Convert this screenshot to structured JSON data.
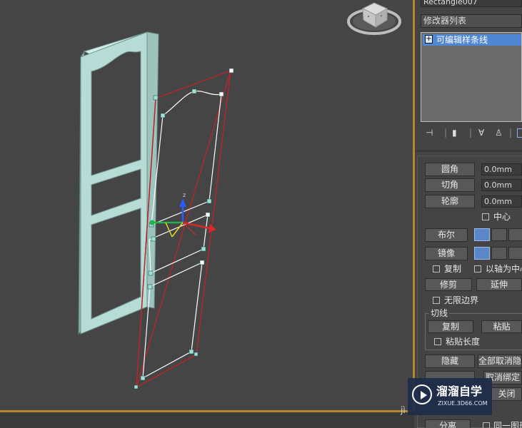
{
  "colors": {
    "viewport_bg": "#454545",
    "frame_fill": "#b7dcd6",
    "selection_red": "#b5262d",
    "spline_white": "#ffffff",
    "highlight_blue": "#4f87d2",
    "active_border": "#b8862f"
  },
  "viewport": {
    "object_name": "Rectangle007",
    "axis_label": "z"
  },
  "panel": {
    "modifier_list_label": "修改器列表",
    "modifier_stack": [
      {
        "label": "可编辑样条线",
        "expand_glyph": "+"
      }
    ],
    "toolbar_icons": [
      "pin-stack-icon",
      "show-end-result-icon",
      "make-unique-icon",
      "remove-modifier-icon",
      "configure-sets-icon"
    ],
    "fillet": {
      "label": "圆角",
      "value": "0.0mm"
    },
    "chamfer": {
      "label": "切角",
      "value": "0.0mm"
    },
    "outline": {
      "label": "轮廓",
      "value": "0.0mm"
    },
    "center_label": "中心",
    "boolean_label": "布尔",
    "mirror_label": "镜像",
    "copy_label": "复制",
    "about_pivot_label": "以轴为中心",
    "trim_label": "修剪",
    "extend_label": "延伸",
    "infinite_bounds_label": "无限边界",
    "tangent_group_label": "切线",
    "tangent_copy_label": "复制",
    "tangent_paste_label": "粘贴",
    "paste_length_label": "粘贴长度",
    "hide_label": "隐藏",
    "unhide_all_label": "全部取消隐藏",
    "unbind_label": "取消绑定",
    "close_label": "关闭",
    "detach_label": "分离",
    "same_shape_label": "同一图形"
  },
  "watermark": {
    "brand": "溜溜自学",
    "url": "ZIXUE.3D66.COM",
    "partial_text": "jì"
  }
}
